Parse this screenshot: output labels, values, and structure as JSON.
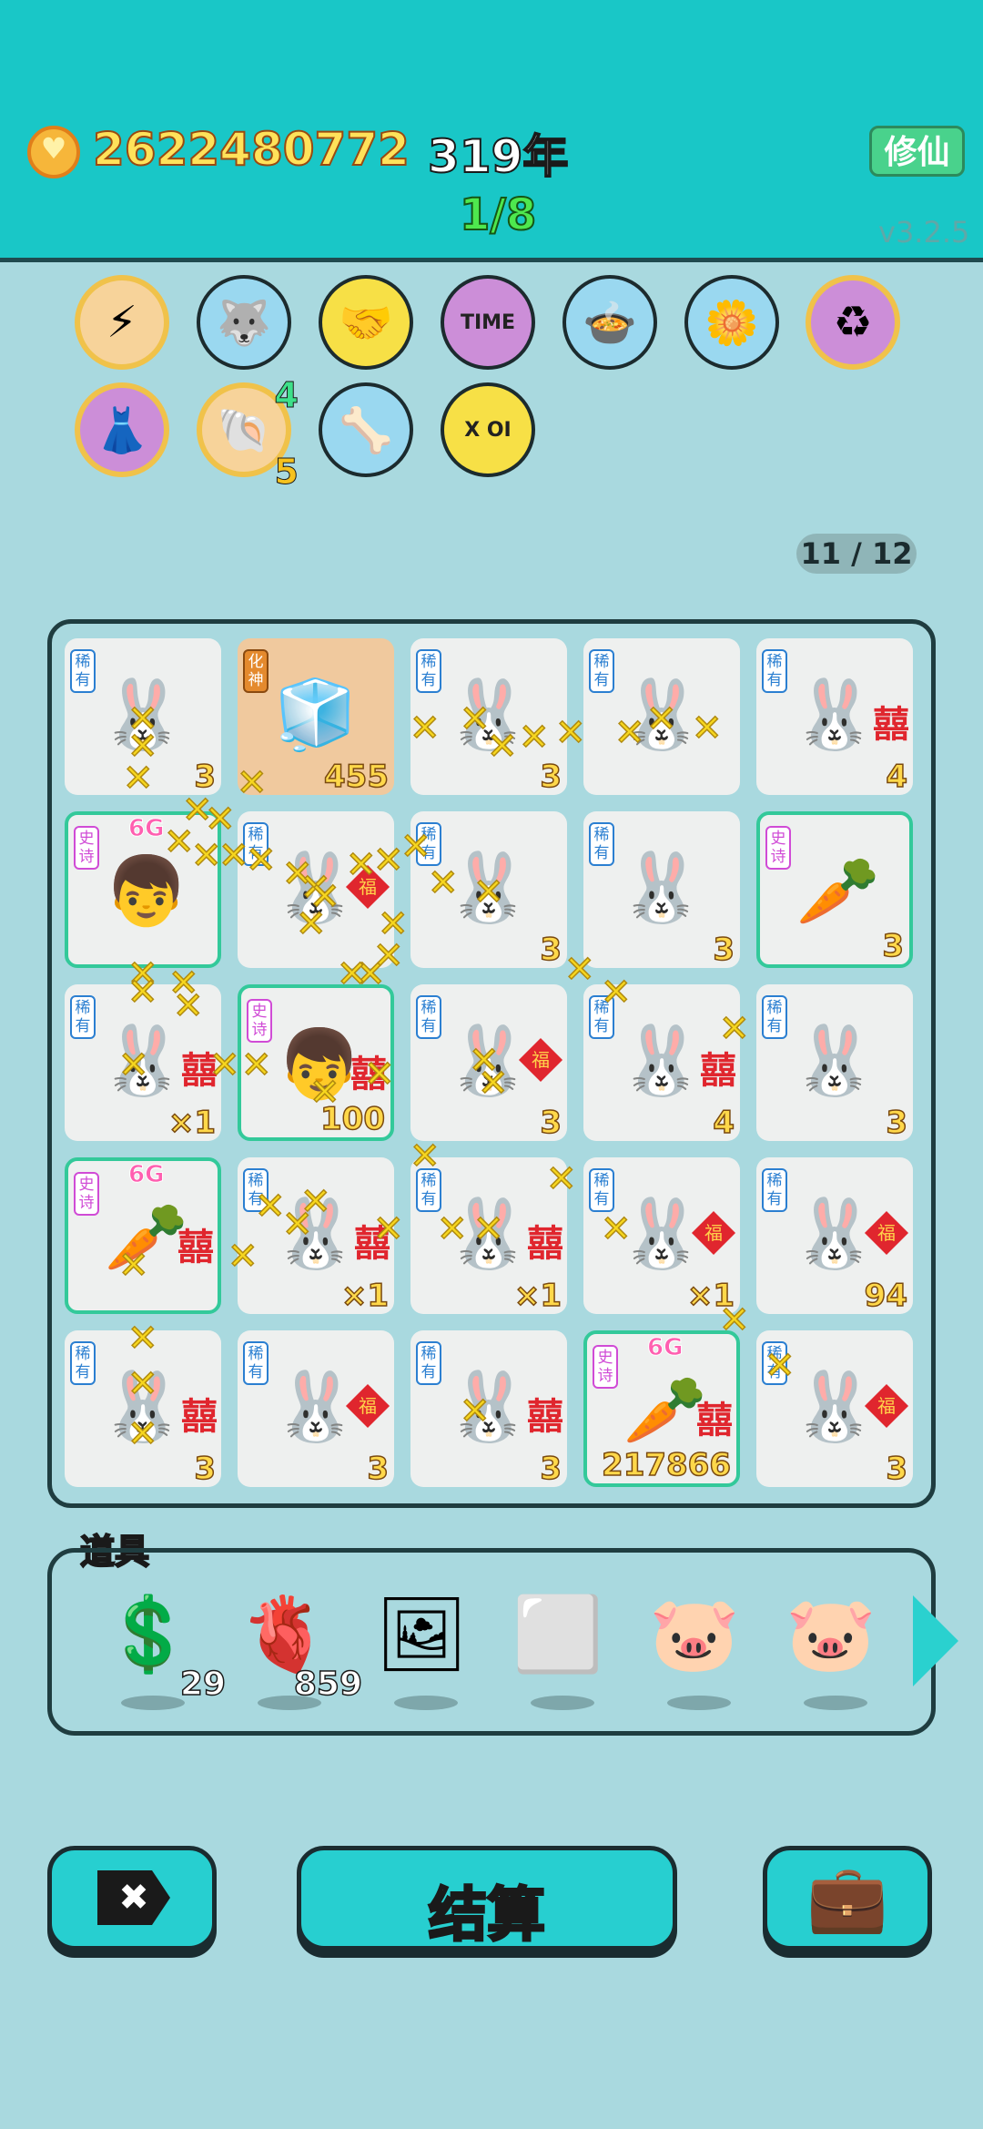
{
  "header": {
    "coins": "2622480772",
    "year": "319年",
    "progress": "1/8",
    "xiuxian_label": "修仙",
    "version": "v3.2.5"
  },
  "relics": [
    {
      "name": "lightning-icon",
      "glyph": "⚡",
      "bg": "#f7d39a",
      "gold": true
    },
    {
      "name": "husky-dog-icon",
      "glyph": "🐺",
      "bg": "#9ad8f0",
      "gold": false
    },
    {
      "name": "handshake-icon",
      "glyph": "🤝",
      "bg": "#f7e046",
      "gold": false
    },
    {
      "name": "time-portrait-icon",
      "glyph": "TIME",
      "bg": "#cc8ed8",
      "gold": false
    },
    {
      "name": "duck-pot-icon",
      "glyph": "🍲",
      "bg": "#9ad8f0",
      "gold": false
    },
    {
      "name": "flower-pot-icon",
      "glyph": "🌼",
      "bg": "#9ad8f0",
      "gold": false
    },
    {
      "name": "recycle-icon",
      "glyph": "♻",
      "bg": "#cc8ed8",
      "gold": true
    },
    {
      "name": "skirt-icon",
      "glyph": "👗",
      "bg": "#cc8ed8",
      "gold": true
    },
    {
      "name": "shell-icon",
      "glyph": "🐚",
      "bg": "#f7d39a",
      "gold": true,
      "badge_top": "4",
      "badge_bottom": "5"
    },
    {
      "name": "dog-bowl-icon",
      "glyph": "🦴",
      "bg": "#9ad8f0",
      "gold": false
    },
    {
      "name": "chip-icon",
      "glyph": "X OI",
      "bg": "#f7e046",
      "gold": false
    }
  ],
  "board": {
    "counter": "11 / 12",
    "cells": [
      {
        "tag": "稀有",
        "kind": "rare",
        "art": "🐰",
        "num": "3"
      },
      {
        "tag": "化神",
        "kind": "god",
        "art": "🧊",
        "num": "455"
      },
      {
        "tag": "稀有",
        "kind": "rare",
        "art": "🐰",
        "num": "3"
      },
      {
        "tag": "稀有",
        "kind": "rare",
        "art": "🐰",
        "num": ""
      },
      {
        "tag": "稀有",
        "kind": "rare",
        "art": "🐰",
        "num": "4",
        "deco": "囍"
      },
      {
        "tag": "史诗",
        "kind": "epic",
        "art": "👦",
        "num": "",
        "g": "6G"
      },
      {
        "tag": "稀有",
        "kind": "rare",
        "art": "🐰",
        "num": "",
        "deco": "福"
      },
      {
        "tag": "稀有",
        "kind": "rare",
        "art": "🐰",
        "num": "3"
      },
      {
        "tag": "稀有",
        "kind": "rare",
        "art": "🐰",
        "num": "3"
      },
      {
        "tag": "史诗",
        "kind": "epic",
        "art": "🥕",
        "num": "3"
      },
      {
        "tag": "稀有",
        "kind": "rare",
        "art": "🐰",
        "num": "×1",
        "deco": "囍"
      },
      {
        "tag": "史诗",
        "kind": "epic",
        "art": "👦",
        "num": "100",
        "deco": "囍"
      },
      {
        "tag": "稀有",
        "kind": "rare",
        "art": "🐰",
        "num": "3",
        "deco": "福"
      },
      {
        "tag": "稀有",
        "kind": "rare",
        "art": "🐰",
        "num": "4",
        "deco": "囍"
      },
      {
        "tag": "稀有",
        "kind": "rare",
        "art": "🐰",
        "num": "3"
      },
      {
        "tag": "史诗",
        "kind": "epic",
        "art": "🥕",
        "num": "",
        "g": "6G",
        "deco": "囍"
      },
      {
        "tag": "稀有",
        "kind": "rare",
        "art": "🐰",
        "num": "×1",
        "deco": "囍"
      },
      {
        "tag": "稀有",
        "kind": "rare",
        "art": "🐰",
        "num": "×1",
        "deco": "囍"
      },
      {
        "tag": "稀有",
        "kind": "rare",
        "art": "🐰",
        "num": "×1",
        "deco": "福"
      },
      {
        "tag": "稀有",
        "kind": "rare",
        "art": "🐰",
        "num": "94",
        "deco": "福"
      },
      {
        "tag": "稀有",
        "kind": "rare",
        "art": "🐰",
        "num": "3",
        "deco": "囍"
      },
      {
        "tag": "稀有",
        "kind": "rare",
        "art": "🐰",
        "num": "3",
        "deco": "福"
      },
      {
        "tag": "稀有",
        "kind": "rare",
        "art": "🐰",
        "num": "3",
        "deco": "囍"
      },
      {
        "tag": "史诗",
        "kind": "epic",
        "art": "🥕",
        "num": "217866",
        "g": "6G",
        "deco": "囍"
      },
      {
        "tag": "稀有",
        "kind": "rare",
        "art": "🐰",
        "num": "3",
        "deco": "福"
      }
    ]
  },
  "props": {
    "title": "道具",
    "items": [
      {
        "name": "coin-item-icon",
        "glyph": "💲",
        "count": "29"
      },
      {
        "name": "liver-item-icon",
        "glyph": "🫀",
        "count": "859"
      },
      {
        "name": "carrot-frame-item-icon",
        "glyph": "🖼",
        "count": ""
      },
      {
        "name": "empty-frame-item-icon",
        "glyph": "⬜",
        "count": ""
      },
      {
        "name": "piggy-bank-item-icon",
        "glyph": "🐷",
        "count": ""
      },
      {
        "name": "piggy-bank-item-icon",
        "glyph": "🐷",
        "count": ""
      }
    ]
  },
  "buttons": {
    "exit_icon": "✖",
    "settle_label": "结算",
    "bag_icon": "💼"
  },
  "colors": {
    "header": "#19c7c7",
    "background": "#a9d9df",
    "rare_tag": "#2b7fd1",
    "epic_tag": "#d04bd6",
    "epic_border": "#33c99a"
  }
}
